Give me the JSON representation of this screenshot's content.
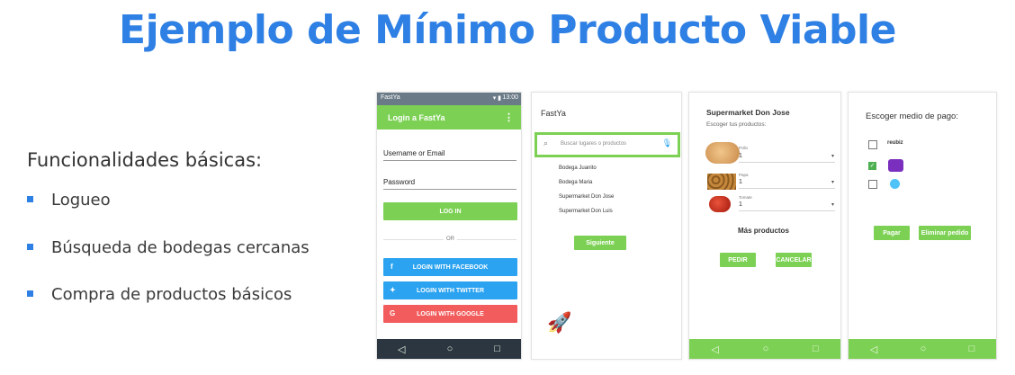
{
  "slide": {
    "title": "Ejemplo de Mínimo Producto Viable",
    "subtitle": "Funcionalidades básicas:",
    "bullets": [
      "Logueo",
      "Búsqueda de bodegas cercanas",
      "Compra de productos básicos"
    ]
  },
  "colors": {
    "accent": "#2f80e4",
    "green": "#7cd154",
    "facebook": "#2ba3f0",
    "twitter": "#2ba3f0",
    "google": "#f25c5c"
  },
  "phone1": {
    "status_app": "FastYa",
    "status_time": "13:00",
    "appbar_title": "Login a FastYa",
    "menu_icon": "more-vert-icon",
    "username_label": "Username or Email",
    "password_label": "Password",
    "login_button": "LOG IN",
    "or_text": "OR",
    "facebook_button": "LOGIN WITH FACEBOOK",
    "twitter_button": "LOGIN WITH TWITTER",
    "google_button": "LOGIN WITH GOOGLE",
    "nav": [
      "◁",
      "○",
      "□"
    ]
  },
  "phone2": {
    "app_title": "FastYa",
    "search_placeholder": "Buscar lugares o productos",
    "results": [
      "Bodega Juanito",
      "Bodega Maria",
      "Supermarket Don Jose",
      "Supermarket Don Luis"
    ],
    "next_button": "Siguiente",
    "rocket_icon": "rocket-icon"
  },
  "phone3": {
    "store_title": "Supermarket Don Jose",
    "subtitle": "Escoger tus productos:",
    "products": [
      {
        "name": "Pollo",
        "qty": "1",
        "icon": "chicken-icon"
      },
      {
        "name": "Papa",
        "qty": "1",
        "icon": "potato-icon"
      },
      {
        "name": "Tomate",
        "qty": "1",
        "icon": "tomato-icon"
      }
    ],
    "more_products": "Más productos",
    "order_button": "PEDIR",
    "cancel_button": "CANCELAR",
    "nav": [
      "◁",
      "○",
      "□"
    ]
  },
  "phone4": {
    "title": "Escoger medio de pago:",
    "options": [
      {
        "label": "reubiz",
        "checked": false
      },
      {
        "label": "",
        "checked": true
      },
      {
        "label": "",
        "checked": false
      }
    ],
    "pay_button": "Pagar",
    "delete_button": "Eliminar pedido",
    "nav": [
      "◁",
      "○",
      "□"
    ]
  }
}
